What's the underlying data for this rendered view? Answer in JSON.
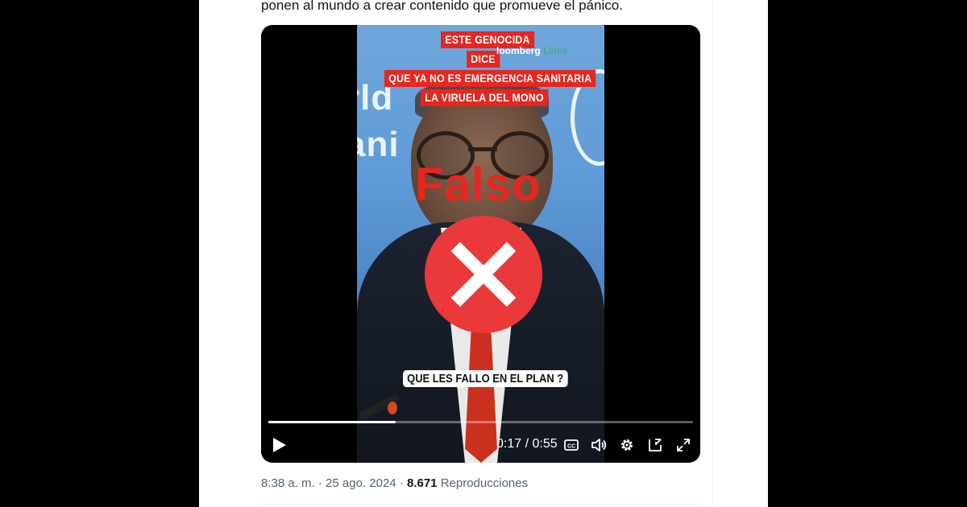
{
  "tweet": {
    "text": "ponen al mundo a crear contenido que promueve el pánico."
  },
  "video": {
    "overlay_captions": [
      "ESTE GENOCIDA",
      "DICE",
      "QUE YA NO ES EMERGENCIA SANITARIA",
      "LA VIRUELA DEL MONO"
    ],
    "background_text": "rld\nani",
    "logo_prefix": "loomberg",
    "logo_suffix": "Línea",
    "verdict_label": "Falso",
    "bottom_caption": "QUE LES FALLO EN EL PLAN ?",
    "current_time": "0:17",
    "duration": "0:55",
    "progress_fraction": 0.3,
    "buffered_fraction": 0.3,
    "time_display": "0:17 / 0:55",
    "controls": [
      "play-icon",
      "captions-icon",
      "volume-icon",
      "settings-icon",
      "dock-icon",
      "fullscreen-icon"
    ]
  },
  "meta": {
    "time": "8:38 a. m.",
    "separator": "·",
    "date": "25 ago. 2024",
    "views_count": "8.671",
    "views_label": "Reproducciones"
  },
  "colors": {
    "accent_red": "#e8261f",
    "badge_red": "#e9393a",
    "meta_gray": "#536471"
  }
}
